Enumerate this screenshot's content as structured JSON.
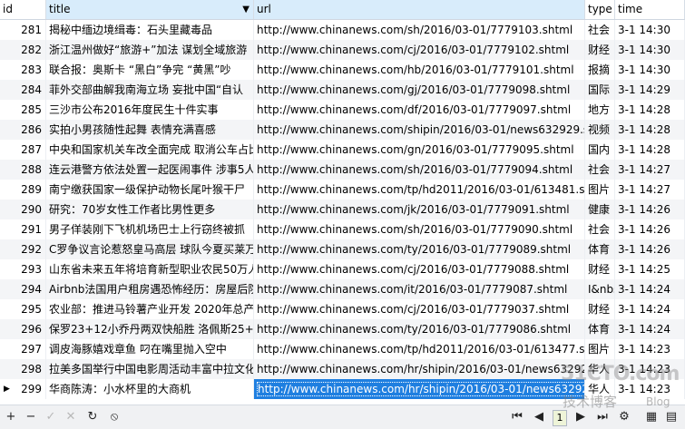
{
  "columns": [
    {
      "key": "id",
      "label": "id"
    },
    {
      "key": "title",
      "label": "title",
      "sorted": true
    },
    {
      "key": "url",
      "label": "url"
    },
    {
      "key": "type",
      "label": "type"
    },
    {
      "key": "time",
      "label": "time"
    }
  ],
  "rows": [
    {
      "id": "281",
      "title": "揭秘中缅边境缉毒：石头里藏毒品",
      "url": "http://www.chinanews.com/sh/2016/03-01/7779103.shtml",
      "type": "社会",
      "time": "3-1 14:30"
    },
    {
      "id": "282",
      "title": "浙江温州做好“旅游+”加法 谋划全域旅游",
      "url": "http://www.chinanews.com/cj/2016/03-01/7779102.shtml",
      "type": "财经",
      "time": "3-1 14:30"
    },
    {
      "id": "283",
      "title": "联合报：奥斯卡 “黑白”争完 “黄黑”吵",
      "url": "http://www.chinanews.com/hb/2016/03-01/7779101.shtml",
      "type": "报摘",
      "time": "3-1 14:30"
    },
    {
      "id": "284",
      "title": "菲外交部曲解我南海立场 妄批中国“自认",
      "url": "http://www.chinanews.com/gj/2016/03-01/7779098.shtml",
      "type": "国际",
      "time": "3-1 14:29"
    },
    {
      "id": "285",
      "title": "三沙市公布2016年度民生十件实事",
      "url": "http://www.chinanews.com/df/2016/03-01/7779097.shtml",
      "type": "地方",
      "time": "3-1 14:28"
    },
    {
      "id": "286",
      "title": "实拍小男孩随性起舞 表情充满喜感",
      "url": "http://www.chinanews.com/shipin/2016/03-01/news632929.shtml",
      "type": "视频",
      "time": "3-1 14:28"
    },
    {
      "id": "287",
      "title": "中央和国家机关车改全面完成 取消公车占比",
      "url": "http://www.chinanews.com/gn/2016/03-01/7779095.shtml",
      "type": "国内",
      "time": "3-1 14:28"
    },
    {
      "id": "288",
      "title": "连云港警方依法处置一起医闹事件 涉事5人",
      "url": "http://www.chinanews.com/sh/2016/03-01/7779094.shtml",
      "type": "社会",
      "time": "3-1 14:27"
    },
    {
      "id": "289",
      "title": "南宁缴获国家一级保护动物长尾叶猴干尸",
      "url": "http://www.chinanews.com/tp/hd2011/2016/03-01/613481.shtml",
      "type": "图片",
      "time": "3-1 14:27"
    },
    {
      "id": "290",
      "title": "研究：70岁女性工作者比男性更多",
      "url": "http://www.chinanews.com/jk/2016/03-01/7779091.shtml",
      "type": "健康",
      "time": "3-1 14:26"
    },
    {
      "id": "291",
      "title": "男子佯装刚下飞机机场巴士上行窃终被抓",
      "url": "http://www.chinanews.com/sh/2016/03-01/7779090.shtml",
      "type": "社会",
      "time": "3-1 14:26"
    },
    {
      "id": "292",
      "title": "C罗争议言论惹怒皇马高层 球队今夏买莱万",
      "url": "http://www.chinanews.com/ty/2016/03-01/7779089.shtml",
      "type": "体育",
      "time": "3-1 14:26"
    },
    {
      "id": "293",
      "title": "山东省未来五年将培育新型职业农民50万人",
      "url": "http://www.chinanews.com/cj/2016/03-01/7779088.shtml",
      "type": "财经",
      "time": "3-1 14:25"
    },
    {
      "id": "294",
      "title": "Airbnb法国用户租房遇恐怖经历：房屋后院",
      "url": "http://www.chinanews.com/it/2016/03-01/7779087.shtml",
      "type": "I&nbs",
      "time": "3-1 14:24"
    },
    {
      "id": "295",
      "title": "农业部：推进马铃薯产业开发 2020年总产",
      "url": "http://www.chinanews.com/cj/2016/03-01/7779037.shtml",
      "type": "财经",
      "time": "3-1 14:24"
    },
    {
      "id": "296",
      "title": "保罗23+12小乔丹两双快船胜 洛佩斯25+1",
      "url": "http://www.chinanews.com/ty/2016/03-01/7779086.shtml",
      "type": "体育",
      "time": "3-1 14:24"
    },
    {
      "id": "297",
      "title": "调皮海豚嬉戏章鱼 叼在嘴里抛入空中",
      "url": "http://www.chinanews.com/tp/hd2011/2016/03-01/613477.shtml",
      "type": "图片",
      "time": "3-1 14:23"
    },
    {
      "id": "298",
      "title": "拉美多国举行中国电影周活动丰富中拉文化",
      "url": "http://www.chinanews.com/hr/shipin/2016/03-01/news632922.shtml",
      "type": "华人",
      "time": "3-1 14:23"
    },
    {
      "id": "299",
      "title": "华商陈涛：小水杯里的大商机",
      "url": "http://www.chinanews.com/hr/shipin/2016/03-01/news632921.shtml",
      "type": "华人",
      "time": "3-1 14:23"
    }
  ],
  "selected_row": "299",
  "icons": {
    "add": "+",
    "remove": "−",
    "apply": "✓",
    "cancel": "✕",
    "refresh": "↻",
    "stop": "⦸",
    "first": "⏮",
    "prev": "◀",
    "next": "▶",
    "last": "⏭",
    "settings": "⚙",
    "grid_view": "▦",
    "form_view": "▤"
  },
  "pager": {
    "page": "1"
  },
  "watermark": {
    "line1": "51CTO.com",
    "line2": "技术博客",
    "line3": "Blog"
  }
}
